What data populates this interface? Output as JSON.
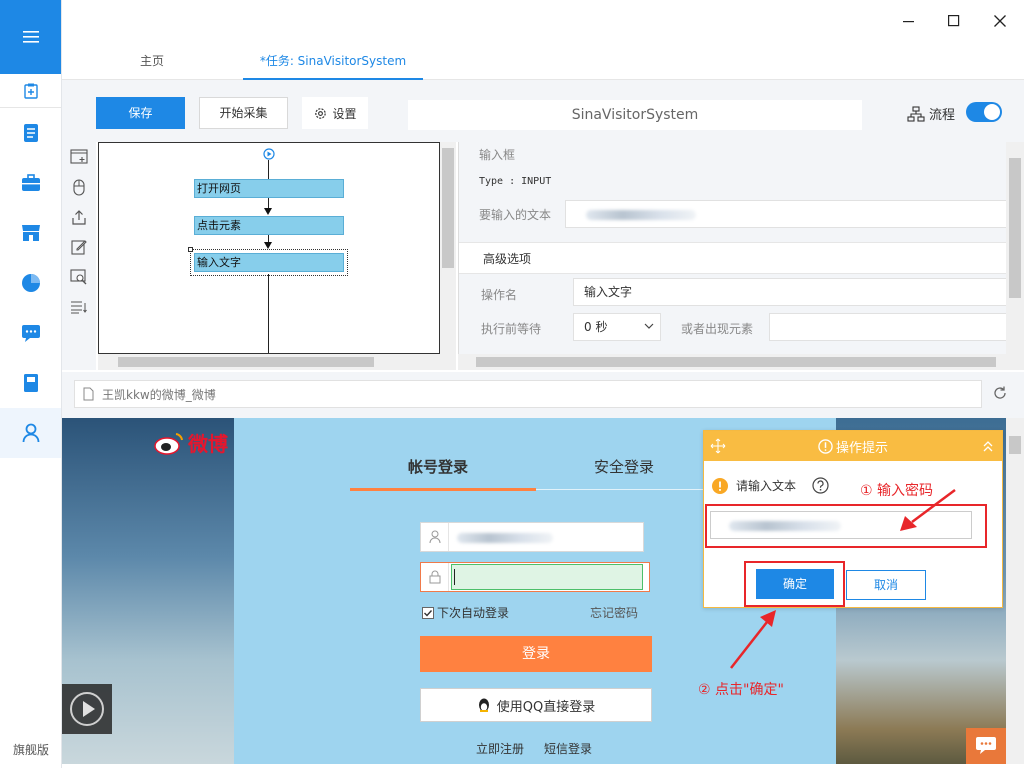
{
  "sidebar": {
    "edition": "旗舰版"
  },
  "tabs": [
    {
      "label": "主页"
    },
    {
      "label": "*任务: SinaVisitorSystem"
    }
  ],
  "toolbar": {
    "save_label": "保存",
    "start_label": "开始采集",
    "settings_label": "设置",
    "task_name": "SinaVisitorSystem",
    "flow_label": "流程"
  },
  "workflow": {
    "nodes": [
      "打开网页",
      "点击元素",
      "输入文字"
    ]
  },
  "properties": {
    "section_title": "输入框",
    "type_text": "Type : INPUT",
    "text_label": "要输入的文本",
    "advanced_label": "高级选项",
    "op_name_label": "操作名",
    "op_name_value": "输入文字",
    "wait_label": "执行前等待",
    "wait_value": "0 秒",
    "or_element_label": "或者出现元素"
  },
  "address_bar": {
    "title": "王凯kkw的微博_微博"
  },
  "weibo": {
    "logo_text": "微博",
    "tab_account": "帐号登录",
    "tab_secure": "安全登录",
    "remember_label": "下次自动登录",
    "forgot_label": "忘记密码",
    "login_label": "登录",
    "qq_label": "使用QQ直接登录",
    "register_label": "立即注册",
    "sms_label": "短信登录"
  },
  "popup": {
    "title": "操作提示",
    "prompt": "请输入文本",
    "ok_label": "确定",
    "cancel_label": "取消"
  },
  "annotations": {
    "step1": "① 输入密码",
    "step2": "② 点击\"确定\""
  },
  "colors": {
    "accent": "#1e88e5",
    "popup_header": "#f9bc42",
    "annotation": "#e8262a",
    "login_button": "#ff8140",
    "node_fill": "#87ceeb"
  }
}
